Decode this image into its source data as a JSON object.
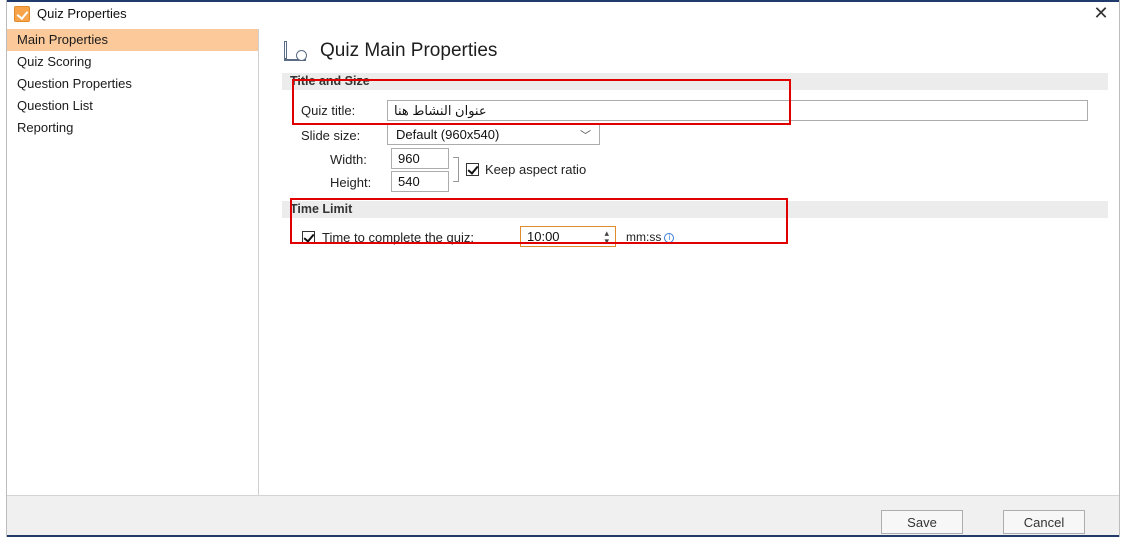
{
  "window": {
    "title": "Quiz Properties",
    "close_glyph": "✕"
  },
  "sidebar": {
    "items": [
      {
        "label": "Main Properties",
        "active": true
      },
      {
        "label": "Quiz Scoring"
      },
      {
        "label": "Question Properties"
      },
      {
        "label": "Question List"
      },
      {
        "label": "Reporting"
      }
    ]
  },
  "main": {
    "title": "Quiz Main Properties",
    "title_icon": "quiz-properties-icon",
    "title_size": {
      "header": "Title and Size",
      "quiz_title_label": "Quiz title:",
      "quiz_title_value": "عنوان النشاط هنا",
      "slide_size_label": "Slide size:",
      "slide_size_value": "Default (960x540)",
      "width_label": "Width:",
      "width_value": "960",
      "height_label": "Height:",
      "height_value": "540",
      "keep_aspect_label": "Keep aspect ratio",
      "keep_aspect_checked": true
    },
    "time_limit": {
      "header": "Time Limit",
      "time_label": "Time to complete the quiz:",
      "time_checked": true,
      "time_value": "10:00",
      "unit": "mm:ss"
    }
  },
  "footer": {
    "save_label": "Save",
    "cancel_label": "Cancel"
  },
  "colors": {
    "active_item": "#fbc99a",
    "highlight": "#e00000",
    "spin_border": "#e08a2e",
    "accent_bar": "#1f3a6b"
  }
}
